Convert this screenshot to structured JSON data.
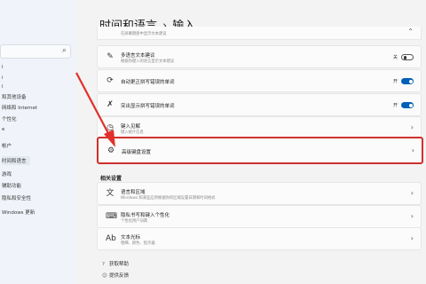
{
  "sidebar": {
    "search_icon": "search-icon",
    "items": [
      {
        "label": "l"
      },
      {
        "label": "i"
      },
      {
        "label": "l"
      },
      {
        "label": "和其他设备"
      },
      {
        "label": "网络和 Internet"
      },
      {
        "label": "个性化"
      },
      {
        "label": "e"
      },
      {
        "label": "帐户"
      },
      {
        "label": "时间和语言"
      },
      {
        "label": "游戏"
      },
      {
        "label": "辅助功能"
      },
      {
        "label": "隐私和安全性"
      },
      {
        "label": "Windows 更新"
      }
    ]
  },
  "header": {
    "parent": "时间和语言",
    "separator": "›",
    "current": "输入"
  },
  "rows": {
    "top_sub": "在屏幕键盘中显示文本建议",
    "multilang": {
      "label": "多语言文本建议",
      "sub": "根据你键入的语言显示文本建议",
      "state": "关"
    },
    "autocorrect": {
      "label": "自动更正拼写错误的单词",
      "state": "开"
    },
    "highlight": {
      "label": "突出显示拼写错误的单词",
      "state": "开"
    },
    "typing": {
      "label": "键入见解",
      "sub": "键入统计信息"
    },
    "advanced": {
      "label": "高级键盘设置"
    }
  },
  "related": {
    "heading": "相关设置",
    "items": [
      {
        "label": "语言和区域",
        "sub": "Windows 和某些应用根据你的区域设置日期和时间格式"
      },
      {
        "label": "隐私书写和键入个性化",
        "sub": "个性化用户词典"
      },
      {
        "label": "文本光标",
        "sub": "粗细、颜色、指示器"
      }
    ]
  },
  "links": [
    {
      "label": "获取帮助"
    },
    {
      "label": "提供反馈"
    }
  ],
  "colors": {
    "accent": "#005fb8",
    "highlight_border": "#d0312d",
    "arrow": "#e0302b"
  }
}
